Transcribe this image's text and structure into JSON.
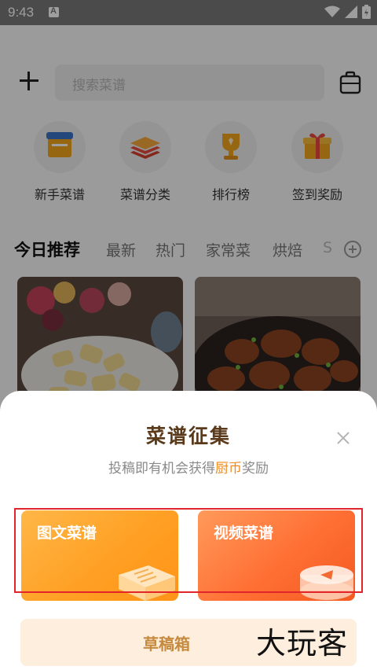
{
  "status_bar": {
    "time": "9:43"
  },
  "top_bar": {
    "search_placeholder": "搜索菜谱"
  },
  "categories": [
    {
      "label": "新手菜谱",
      "icon": "beginner-recipe-icon"
    },
    {
      "label": "菜谱分类",
      "icon": "category-layers-icon"
    },
    {
      "label": "排行榜",
      "icon": "trophy-icon"
    },
    {
      "label": "签到奖励",
      "icon": "gift-icon"
    }
  ],
  "tabs": [
    {
      "label": "今日推荐",
      "active": true
    },
    {
      "label": "最新"
    },
    {
      "label": "热门"
    },
    {
      "label": "家常菜"
    },
    {
      "label": "烘焙"
    },
    {
      "label": "S"
    }
  ],
  "sheet": {
    "title": "菜谱征集",
    "subtitle_prefix": "投稿即有机会获得",
    "subtitle_highlight": "厨币",
    "subtitle_suffix": "奖励",
    "options": [
      {
        "label": "图文菜谱",
        "icon": "recipe-paper-icon"
      },
      {
        "label": "视频菜谱",
        "icon": "video-play-icon"
      }
    ],
    "draft_label": "草稿箱"
  },
  "watermark": "大玩客",
  "colors": {
    "title_brown": "#5a3a1a",
    "highlight_orange": "#f08a1c",
    "option_image_text": "#ffa024",
    "option_video": "#ff6f34",
    "annotation_red": "#e2252a"
  }
}
